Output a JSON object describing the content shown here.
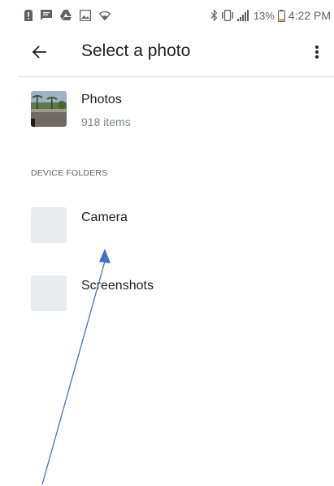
{
  "status_bar": {
    "battery_percent": "13%",
    "time": "4:22 PM",
    "left_icons": [
      "sim-alert-icon",
      "message-icon",
      "drive-icon",
      "gallery-icon",
      "wifi-icon"
    ],
    "right_icons": [
      "bluetooth-icon",
      "vibrate-icon",
      "signal-icon",
      "battery-icon"
    ]
  },
  "app_bar": {
    "title": "Select a photo",
    "back_icon": "arrow-back-icon",
    "more_icon": "more-vert-icon"
  },
  "photos": {
    "title": "Photos",
    "subtitle": "918 items"
  },
  "device_folders": {
    "header": "DEVICE FOLDERS",
    "items": [
      {
        "label": "Camera"
      },
      {
        "label": "Screenshots"
      }
    ]
  },
  "colors": {
    "annotation_arrow": "#4472c4",
    "folder_placeholder": "#e8eaed",
    "divider": "#dadce0"
  }
}
